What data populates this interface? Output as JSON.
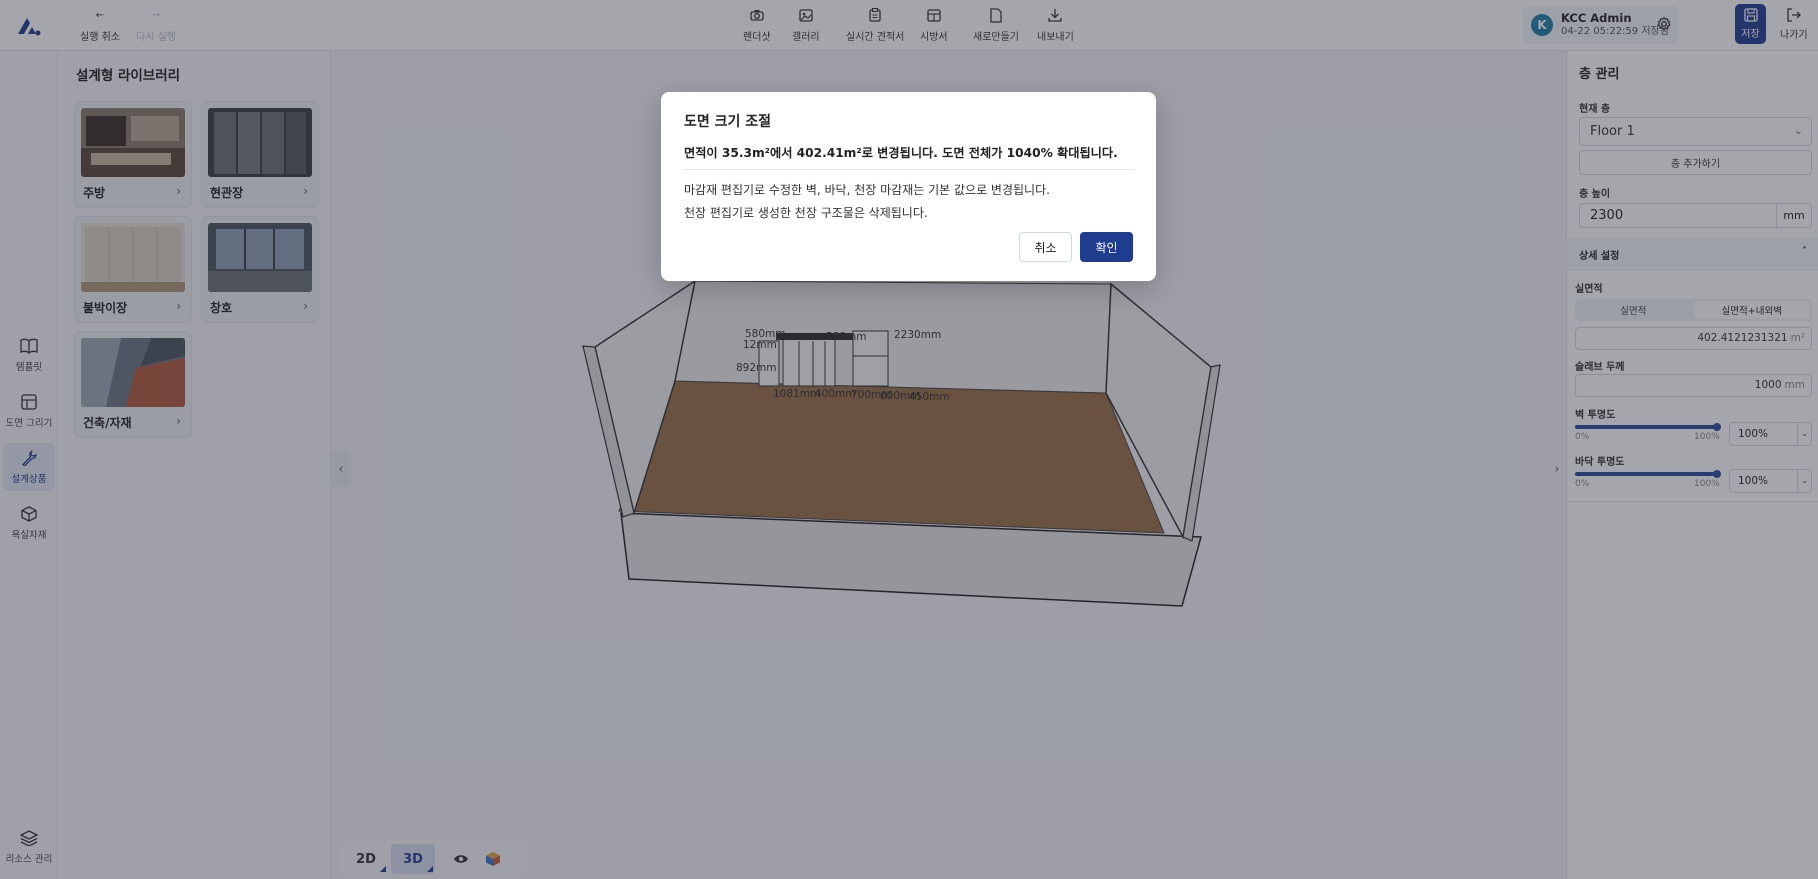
{
  "toolbar": {
    "undo": "실행 취소",
    "redo": "다시 실행",
    "render": "렌더샷",
    "gallery": "갤러리",
    "estimate": "실시간 견적서",
    "spec": "시방서",
    "new": "새로만들기",
    "export": "내보내기",
    "save": "저장",
    "exit": "나가기"
  },
  "user": {
    "initial": "K",
    "name": "KCC Admin",
    "saved_time": "04-22 05:22:59 저장됨"
  },
  "nav": [
    {
      "label": "템플릿",
      "icon": "book-icon"
    },
    {
      "label": "도면 그리기",
      "icon": "floorplan-icon"
    },
    {
      "label": "설계상품",
      "icon": "wrench-icon"
    },
    {
      "label": "욕실자재",
      "icon": "cube-icon"
    },
    {
      "label": "리소스 관리",
      "icon": "layers-icon"
    }
  ],
  "library": {
    "title": "설계형 라이브러리",
    "cards": [
      {
        "label": "주방"
      },
      {
        "label": "현관장"
      },
      {
        "label": "붙박이장"
      },
      {
        "label": "창호"
      },
      {
        "label": "건축/자재"
      }
    ]
  },
  "viewport": {
    "dimensions": [
      "580mm",
      "12mm",
      "580mm",
      "2230mm",
      "892mm",
      "1081mm",
      "400mm",
      "700mm",
      "600mm",
      "450mm"
    ]
  },
  "view_toggle": {
    "2d": "2D",
    "3d": "3D"
  },
  "floor_panel": {
    "title": "층 관리",
    "current_floor_label": "현재 층",
    "current_floor": "Floor 1",
    "add_floor": "층 추가하기",
    "height_label": "층 높이",
    "height_value": "2300",
    "height_unit": "mm",
    "detail_section": "상세 설정",
    "area_label": "실면적",
    "area_tab1": "실면적",
    "area_tab2": "실면적+내외벽",
    "area_value": "402.4121231321",
    "area_unit": "m²",
    "slab_label": "슬래브 두께",
    "slab_value": "1000",
    "slab_unit": "mm",
    "wall_opacity_label": "벽 투명도",
    "floor_opacity_label": "바닥 투명도",
    "slider_min": "0%",
    "slider_max": "100%",
    "wall_opacity": "100%",
    "floor_opacity": "100%",
    "wall_opacity_level": 1.0,
    "floor_opacity_level": 1.0
  },
  "modal": {
    "title": "도면 크기 조절",
    "subtitle": "면적이 35.3m²에서 402.41m²로 변경됩니다. 도면 전체가 1040% 확대됩니다.",
    "body1": "마감재 편집기로 수정한 벽, 바닥, 천장 마감재는 기본 값으로 변경됩니다.",
    "body2": "천장 편집기로 생성한 천장 구조물은 삭제됩니다.",
    "cancel": "취소",
    "confirm": "확인"
  },
  "colors": {
    "accent": "#1f3d8f",
    "floor_wood": "#9a6f47"
  }
}
